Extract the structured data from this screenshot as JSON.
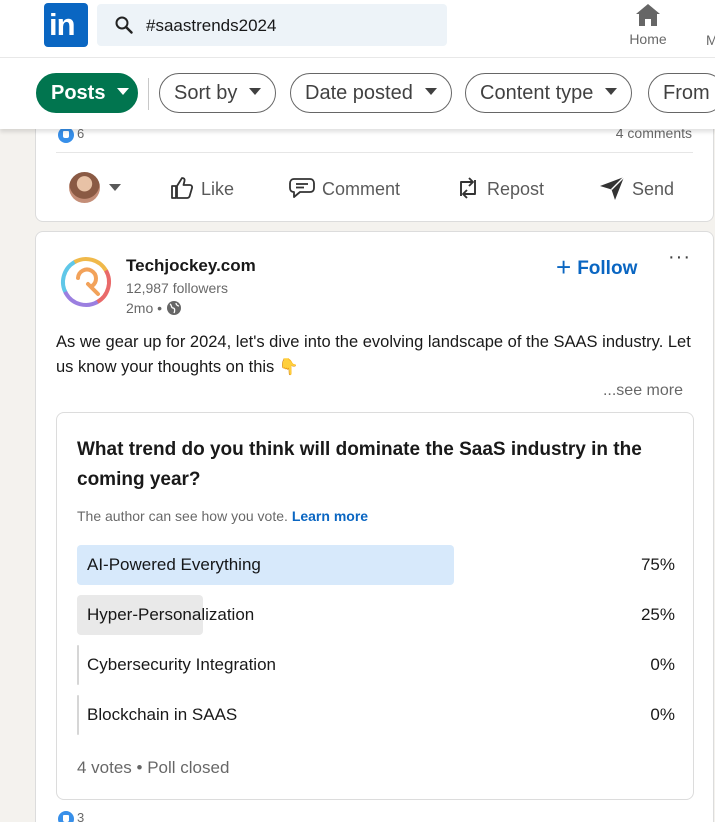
{
  "header": {
    "logo_text": "in",
    "search_value": "#saastrends2024",
    "nav_home_label": "Home",
    "nav_next_partial": "M"
  },
  "filters": {
    "posts_label": "Posts",
    "sort_label": "Sort by",
    "date_label": "Date posted",
    "content_label": "Content type",
    "from_label": "From"
  },
  "prev_post": {
    "reaction_count": "6",
    "comments": "4 comments",
    "actions": {
      "like": "Like",
      "comment": "Comment",
      "repost": "Repost",
      "send": "Send"
    }
  },
  "post": {
    "company_name": "Techjockey.com",
    "followers": "12,987 followers",
    "time": "2mo •",
    "follow_label": "Follow",
    "more_label": "···",
    "text": "As we gear up for 2024, let's dive into the evolving landscape of the SAAS industry. Let us know your thoughts on this",
    "emoji": "👇",
    "see_more": "...see more",
    "reaction_count": "3"
  },
  "poll": {
    "question": "What trend do you think will dominate the SaaS industry in the coming year?",
    "note": "The author can see how you vote.",
    "learn_more": "Learn more",
    "options": [
      {
        "label": "AI-Powered Everything",
        "percent_text": "75%",
        "percent": 75,
        "color": "#d7e9fb"
      },
      {
        "label": "Hyper-Personalization",
        "percent_text": "25%",
        "percent": 25,
        "color": "#e9e9e9"
      },
      {
        "label": "Cybersecurity Integration",
        "percent_text": "0%",
        "percent": 0,
        "color": "#e9e9e9"
      },
      {
        "label": "Blockchain in SAAS",
        "percent_text": "0%",
        "percent": 0,
        "color": "#e9e9e9"
      }
    ],
    "footer": "4 votes • Poll closed"
  },
  "colors": {
    "brand_blue": "#0a66c2",
    "posts_green": "#01754f"
  }
}
